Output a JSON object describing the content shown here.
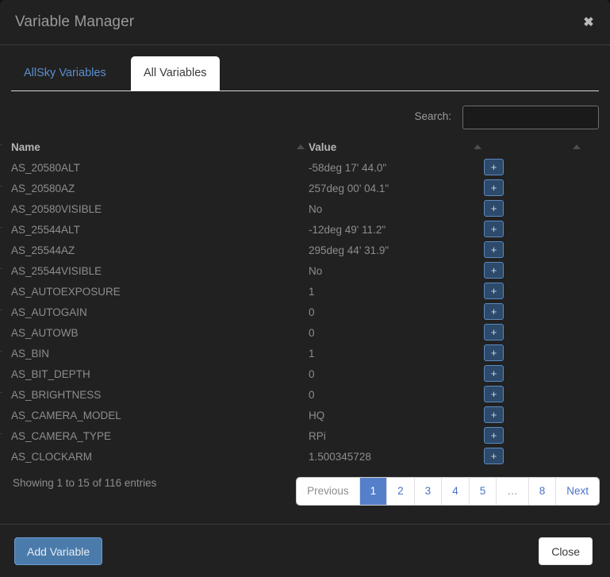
{
  "modal": {
    "title": "Variable Manager",
    "close_icon": "close-x-icon"
  },
  "tabs": [
    {
      "label": "AllSky Variables",
      "active": false
    },
    {
      "label": "All Variables",
      "active": true
    }
  ],
  "search": {
    "label": "Search:",
    "value": "",
    "placeholder": ""
  },
  "table": {
    "columns": [
      "Name",
      "Value"
    ],
    "rows": [
      {
        "name": "AS_20580ALT",
        "value": "-58deg 17' 44.0\"",
        "action": "+"
      },
      {
        "name": "AS_20580AZ",
        "value": "257deg 00' 04.1\"",
        "action": "+"
      },
      {
        "name": "AS_20580VISIBLE",
        "value": "No",
        "action": "+"
      },
      {
        "name": "AS_25544ALT",
        "value": "-12deg 49' 11.2\"",
        "action": "+"
      },
      {
        "name": "AS_25544AZ",
        "value": "295deg 44' 31.9\"",
        "action": "+"
      },
      {
        "name": "AS_25544VISIBLE",
        "value": "No",
        "action": "+"
      },
      {
        "name": "AS_AUTOEXPOSURE",
        "value": "1",
        "action": "+"
      },
      {
        "name": "AS_AUTOGAIN",
        "value": "0",
        "action": "+"
      },
      {
        "name": "AS_AUTOWB",
        "value": "0",
        "action": "+"
      },
      {
        "name": "AS_BIN",
        "value": "1",
        "action": "+"
      },
      {
        "name": "AS_BIT_DEPTH",
        "value": "0",
        "action": "+"
      },
      {
        "name": "AS_BRIGHTNESS",
        "value": "0",
        "action": "+"
      },
      {
        "name": "AS_CAMERA_MODEL",
        "value": "HQ",
        "action": "+"
      },
      {
        "name": "AS_CAMERA_TYPE",
        "value": "RPi",
        "action": "+"
      },
      {
        "name": "AS_CLOCKARM",
        "value": "1.500345728",
        "action": "+"
      }
    ]
  },
  "info": "Showing 1 to 15 of 116 entries",
  "pagination": [
    {
      "label": "Previous",
      "state": "disabled"
    },
    {
      "label": "1",
      "state": "active"
    },
    {
      "label": "2",
      "state": "normal"
    },
    {
      "label": "3",
      "state": "normal"
    },
    {
      "label": "4",
      "state": "normal"
    },
    {
      "label": "5",
      "state": "normal"
    },
    {
      "label": "…",
      "state": "ellipsis"
    },
    {
      "label": "8",
      "state": "normal"
    },
    {
      "label": "Next",
      "state": "normal"
    }
  ],
  "footer": {
    "add_variable_label": "Add Variable",
    "close_label": "Close"
  },
  "colors": {
    "modal_bg": "#212121",
    "accent_blue": "#5580c9",
    "link_blue": "#5b8ed0",
    "add_button": "#4b7bab",
    "plus_button": "#2d4a6b",
    "text_muted": "#8d8d8d"
  }
}
